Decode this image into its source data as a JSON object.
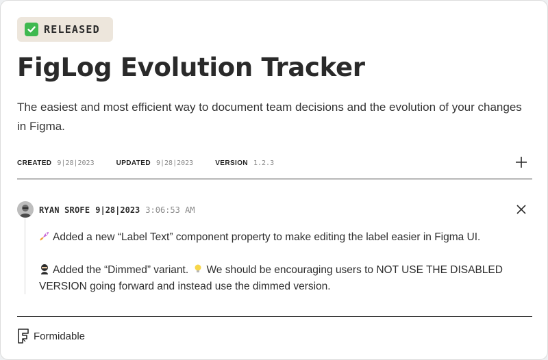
{
  "status": {
    "label": "RELEASED",
    "icon": "check-box-icon",
    "color": "#3fb950"
  },
  "title": "FigLog Evolution Tracker",
  "description": "The easiest and most efficient way to document team decisions and the evolution of your changes in Figma.",
  "meta": {
    "created_label": "CREATED",
    "created_value": "9|28|2023",
    "updated_label": "UPDATED",
    "updated_value": "9|28|2023",
    "version_label": "VERSION",
    "version_value": "1.2.3"
  },
  "actions": {
    "add_icon": "plus-icon",
    "close_icon": "close-icon"
  },
  "entry": {
    "author": "RYAN SROFE",
    "date": "9|28|2023",
    "time": "3:06:53 AM",
    "paragraph_1": "Added a new “Label Text” component property to make editing the label easier in Figma UI.",
    "paragraph_2_a": "Added the “Dimmed” variant.",
    "paragraph_2_b": "We should be encouraging users to NOT USE THE DISABLED VERSION going forward and instead use the dimmed version.",
    "icons": [
      "rocket-icon",
      "ninja-icon",
      "lightbulb-icon"
    ]
  },
  "footer": {
    "brand": "Formidable"
  }
}
